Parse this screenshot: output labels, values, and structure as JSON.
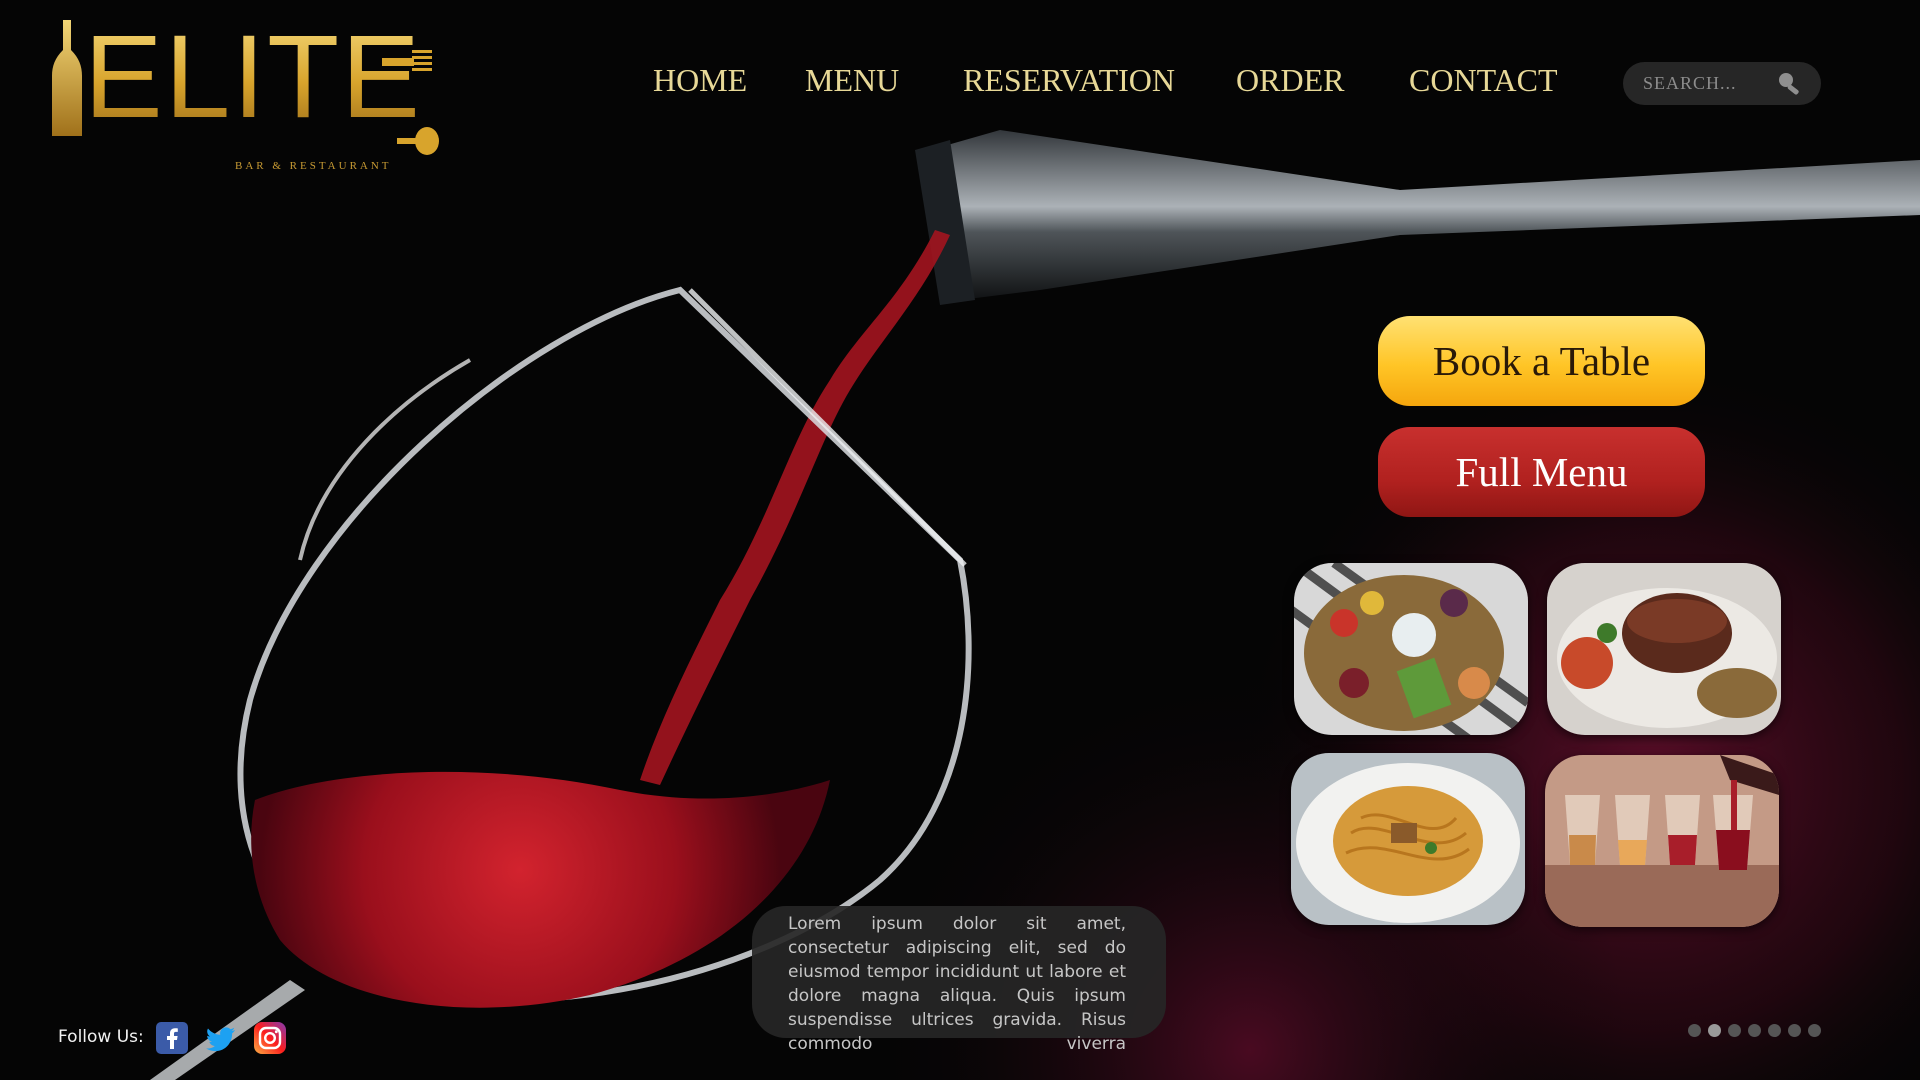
{
  "brand": {
    "name": "ELITE",
    "tagline": "BAR & RESTAURANT",
    "gold": "#d8a42c"
  },
  "nav": {
    "items": [
      {
        "label": "HOME"
      },
      {
        "label": "MENU"
      },
      {
        "label": "RESERVATION"
      },
      {
        "label": "ORDER"
      },
      {
        "label": "CONTACT"
      }
    ],
    "color": "#e7d897"
  },
  "search": {
    "placeholder": "SEARCH...",
    "icon": "search-icon"
  },
  "cta": {
    "book_label": "Book a Table",
    "menu_label": "Full Menu",
    "book_color": "#ffc526",
    "menu_color": "#b1211f"
  },
  "gallery": [
    {
      "name": "charcuterie-board"
    },
    {
      "name": "steak-dish"
    },
    {
      "name": "spaghetti-dish"
    },
    {
      "name": "wine-glasses"
    }
  ],
  "intro": {
    "text": "Lorem ipsum dolor sit amet, consectetur adipiscing elit, sed do eiusmod tempor incididunt ut labore et dolore magna aliqua. Quis ipsum suspendisse ultrices gravida. Risus commodo viverra"
  },
  "social": {
    "label": "Follow Us:",
    "icons": [
      "facebook-icon",
      "twitter-icon",
      "instagram-icon"
    ]
  },
  "carousel": {
    "count": 7,
    "active_index": 1
  }
}
